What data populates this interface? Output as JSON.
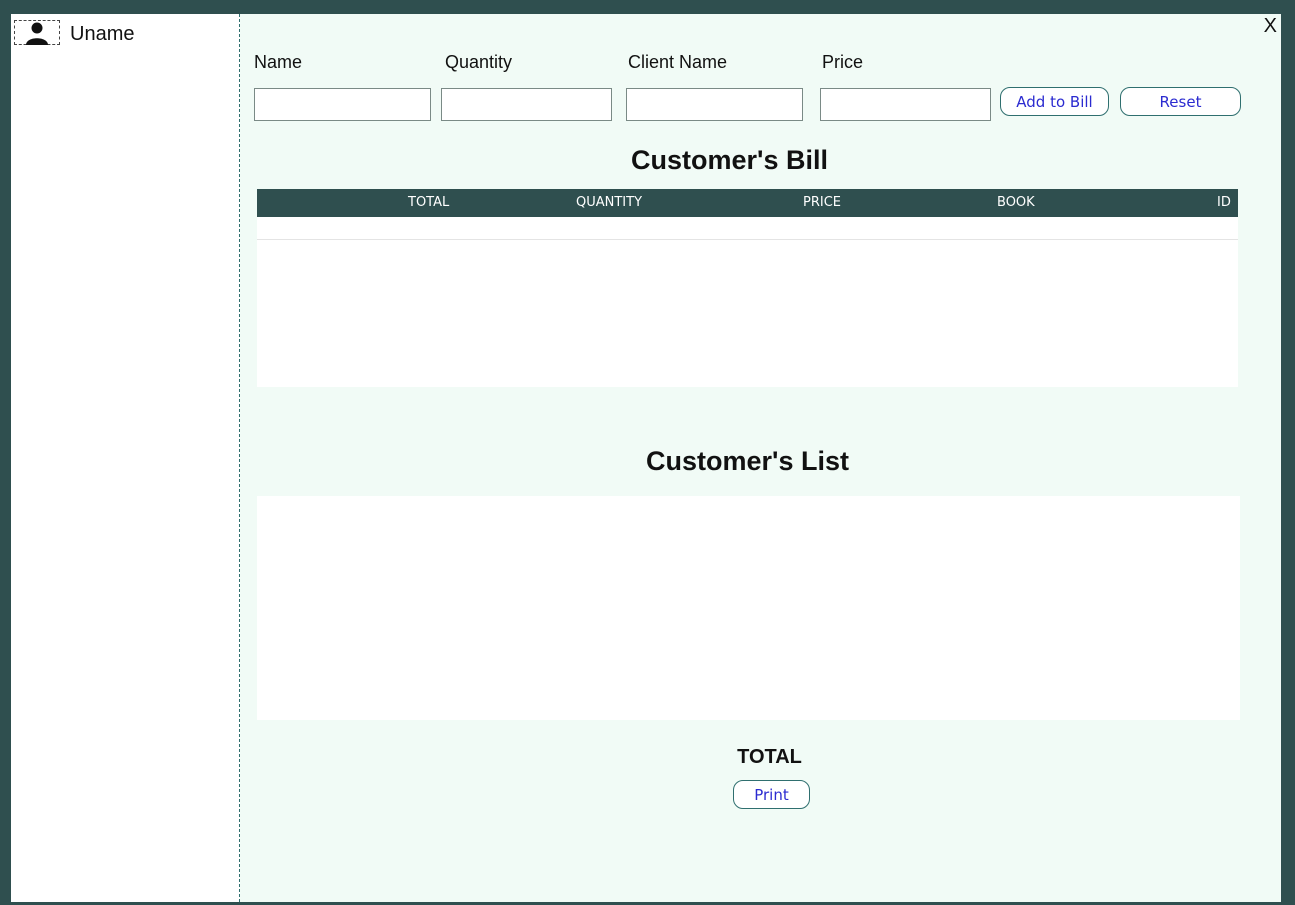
{
  "user": {
    "name": "Uname",
    "icon": "user-icon"
  },
  "window": {
    "close_label": "X"
  },
  "form": {
    "name_label": "Name",
    "quantity_label": "Quantity",
    "client_name_label": "Client Name",
    "price_label": "Price",
    "name_value": "",
    "quantity_value": "",
    "client_name_value": "",
    "price_value": "",
    "add_button": "Add to Bill",
    "reset_button": "Reset"
  },
  "bill": {
    "title": "Customer's Bill",
    "columns": [
      "TOTAL",
      "QUANTITY",
      "PRICE",
      "BOOK",
      "ID"
    ],
    "rows": []
  },
  "list": {
    "title": "Customer's List",
    "items": []
  },
  "footer": {
    "total_label": "TOTAL",
    "print_button": "Print"
  },
  "colors": {
    "header_bg": "#2f4f4f",
    "panel_bg": "#f1fbf6",
    "button_text": "#2b2bd0"
  }
}
